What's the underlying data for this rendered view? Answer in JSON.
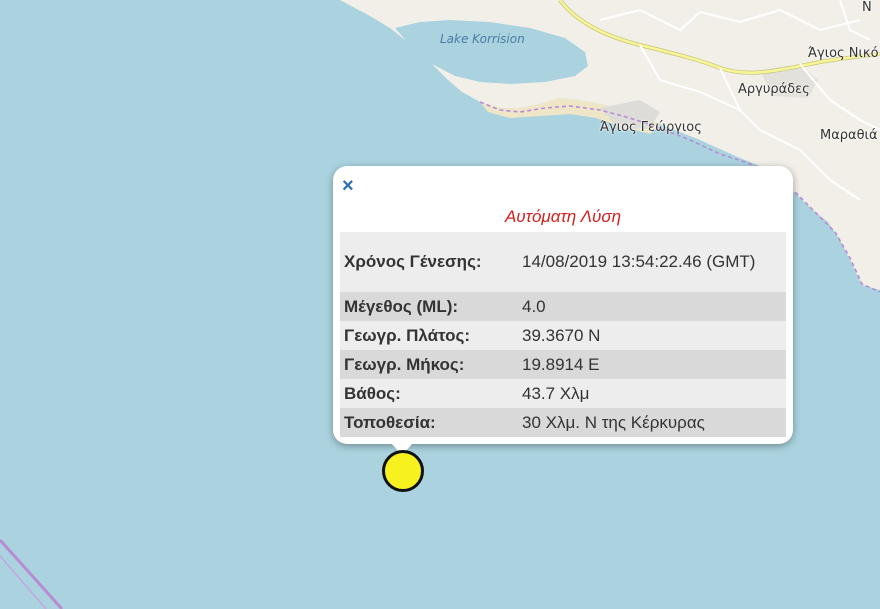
{
  "map": {
    "places": {
      "lake": "Lake Korrision",
      "agios_nikolaos": "Άγιος Νικό",
      "argyrades": "Αργυράδες",
      "agios_georgios": "Άγιος Γεώργιος",
      "marathias": "Μαραθιά",
      "partial_n": "Ν"
    },
    "colors": {
      "sea": "#aad3df",
      "land": "#f2efe9",
      "beach": "#efe6c8",
      "road": "#f6f59c",
      "boundary": "#b88cd4",
      "marker": "#f7f21f"
    }
  },
  "popup": {
    "close_glyph": "×",
    "title": "Αυτόματη Λύση",
    "rows": [
      {
        "label": "Χρόνος Γένεσης:",
        "value": "14/08/2019 13:54:22.46 (GMT)"
      },
      {
        "label": "Μέγεθος (ML):",
        "value": "4.0"
      },
      {
        "label": "Γεωγρ. Πλάτος:",
        "value": "39.3670 N"
      },
      {
        "label": "Γεωγρ. Μήκος:",
        "value": "19.8914 E"
      },
      {
        "label": "Βάθος:",
        "value": "43.7 Χλμ"
      },
      {
        "label": "Τοποθεσία:",
        "value": "30 Χλμ. Ν της Κέρκυρας"
      }
    ]
  },
  "marker": {
    "icon": "earthquake-marker-icon"
  }
}
